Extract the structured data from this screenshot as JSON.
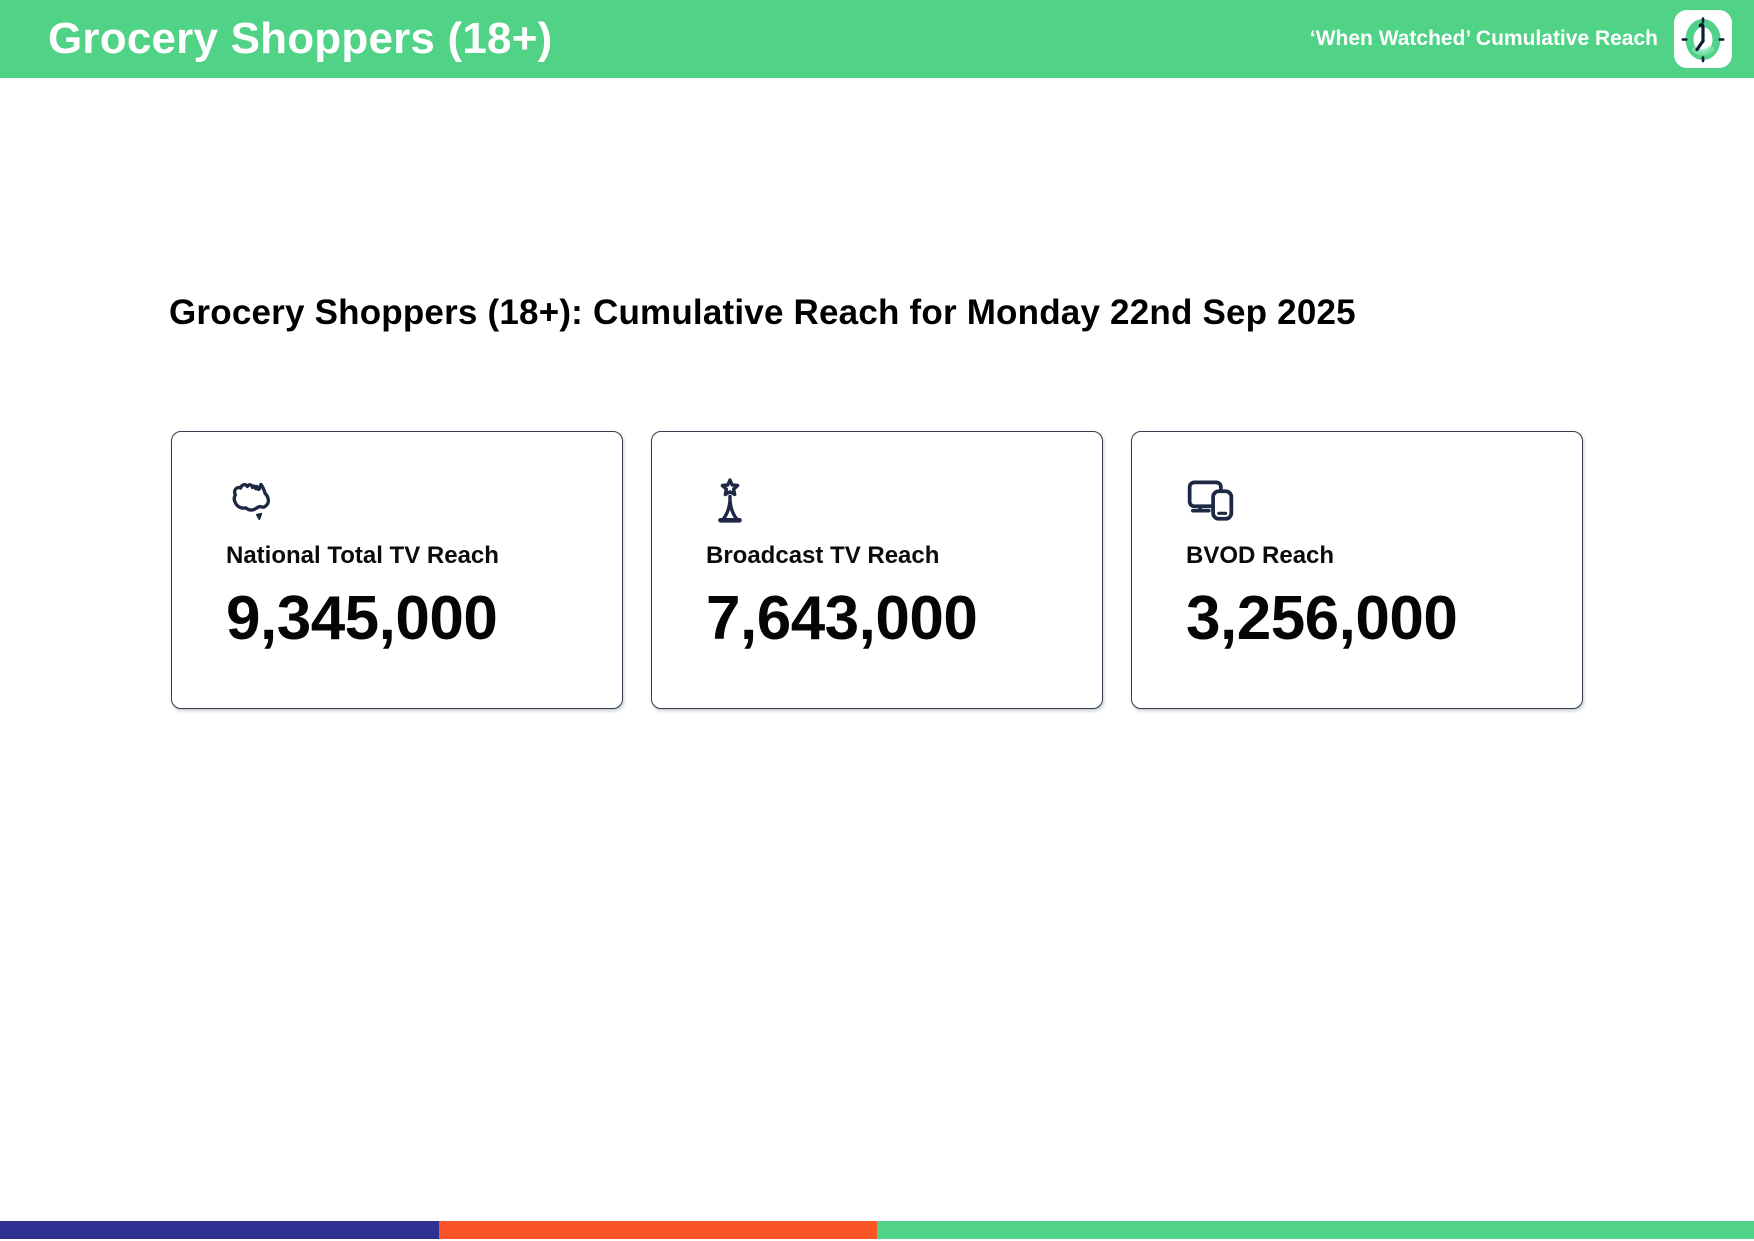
{
  "header": {
    "title": "Grocery Shoppers (18+)",
    "subtitle": "‘When Watched’ Cumulative Reach",
    "background_color": "#50d287",
    "icon": "clock-icon"
  },
  "main": {
    "heading": "Grocery Shoppers (18+): Cumulative Reach for Monday 22nd Sep 2025",
    "cards": [
      {
        "icon": "australia-map-icon",
        "label": "National Total TV Reach",
        "value": "9,345,000"
      },
      {
        "icon": "broadcast-tower-icon",
        "label": "Broadcast TV Reach",
        "value": "7,643,000"
      },
      {
        "icon": "devices-icon",
        "label": "BVOD Reach",
        "value": "3,256,000"
      }
    ],
    "card_border_color": "#323c4e",
    "icon_color": "#1d2845"
  },
  "footer": {
    "segments": [
      {
        "name": "indigo",
        "color": "#2e3192",
        "width_pct": 25
      },
      {
        "name": "orange",
        "color": "#fb5426",
        "width_pct": 25
      },
      {
        "name": "green",
        "color": "#50d287",
        "width_pct": 50
      }
    ]
  }
}
